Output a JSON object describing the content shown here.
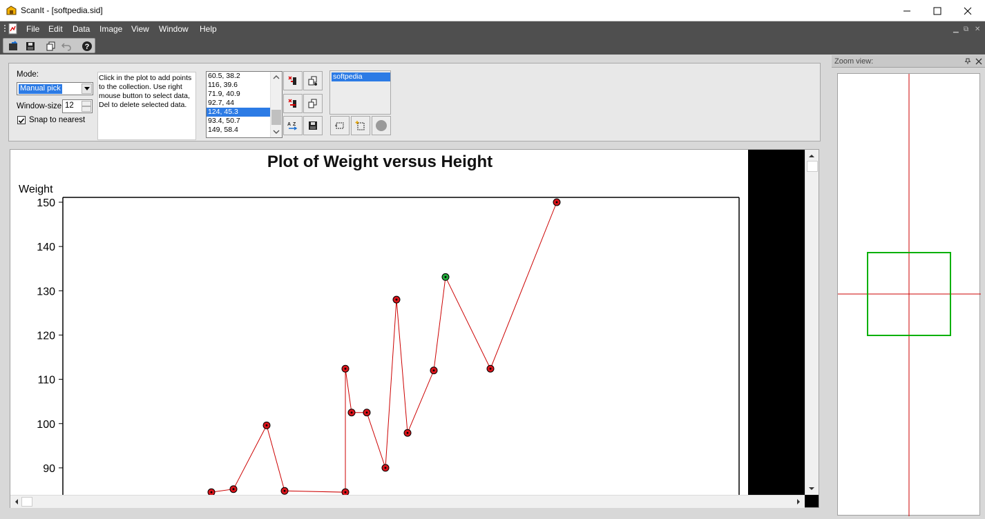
{
  "window": {
    "title": "ScanIt - [softpedia.sid]",
    "minimize_icon": "minimize-icon",
    "maximize_icon": "maximize-icon",
    "close_icon": "close-icon"
  },
  "menubar": {
    "items": [
      "File",
      "Edit",
      "Data",
      "Image",
      "View",
      "Window",
      "Help"
    ]
  },
  "toolbar": {
    "icons": [
      "open-icon",
      "save-icon",
      "copy-icon",
      "undo-icon",
      "help-icon"
    ]
  },
  "controls": {
    "mode_label": "Mode:",
    "mode_value": "Manual pick",
    "window_size_label": "Window-size:",
    "window_size_value": "12",
    "snap_label": "Snap to nearest",
    "snap_checked": true,
    "help_text": "Click in the plot to add points to the collection. Use right mouse button to select data, Del to delete selected data.",
    "points": [
      "60.5, 38.2",
      "116, 39.6",
      "71.9, 40.9",
      "92.7, 44",
      "124, 45.3",
      "93.4, 50.7",
      "149, 58.4"
    ],
    "selected_point_index": 4,
    "datasets": [
      "softpedia"
    ]
  },
  "plot": {
    "title": "Plot of Weight versus Height",
    "ylabel": "Weight",
    "yticks": [
      "150",
      "140",
      "130",
      "120",
      "110",
      "100",
      "90"
    ]
  },
  "zoom": {
    "title": "Zoom view:",
    "pin_icon": "pin-icon",
    "close_icon": "close-icon"
  },
  "colors": {
    "point_fill": "#d9141b",
    "selected_point_fill": "#22a83a",
    "line": "#cc0000",
    "zoom_box": "#00b000",
    "zoom_crosshair": "#cc0000",
    "selection": "#2c7be5"
  },
  "chart_data": {
    "type": "line",
    "title": "Plot of Weight versus Height",
    "xlabel": "",
    "ylabel": "Weight",
    "ylim": [
      85,
      151
    ],
    "points": [
      {
        "y": 84.5
      },
      {
        "y": 85.2
      },
      {
        "y": 99.6
      },
      {
        "y": 84.8
      },
      {
        "y": 84.5
      },
      {
        "y": 112.4
      },
      {
        "y": 102.5
      },
      {
        "y": 102.5
      },
      {
        "y": 90
      },
      {
        "y": 128
      },
      {
        "y": 97.9
      },
      {
        "y": 112
      },
      {
        "y": 133.1,
        "selected": true
      },
      {
        "y": 112.4
      },
      {
        "y": 150
      }
    ],
    "grid": false
  }
}
